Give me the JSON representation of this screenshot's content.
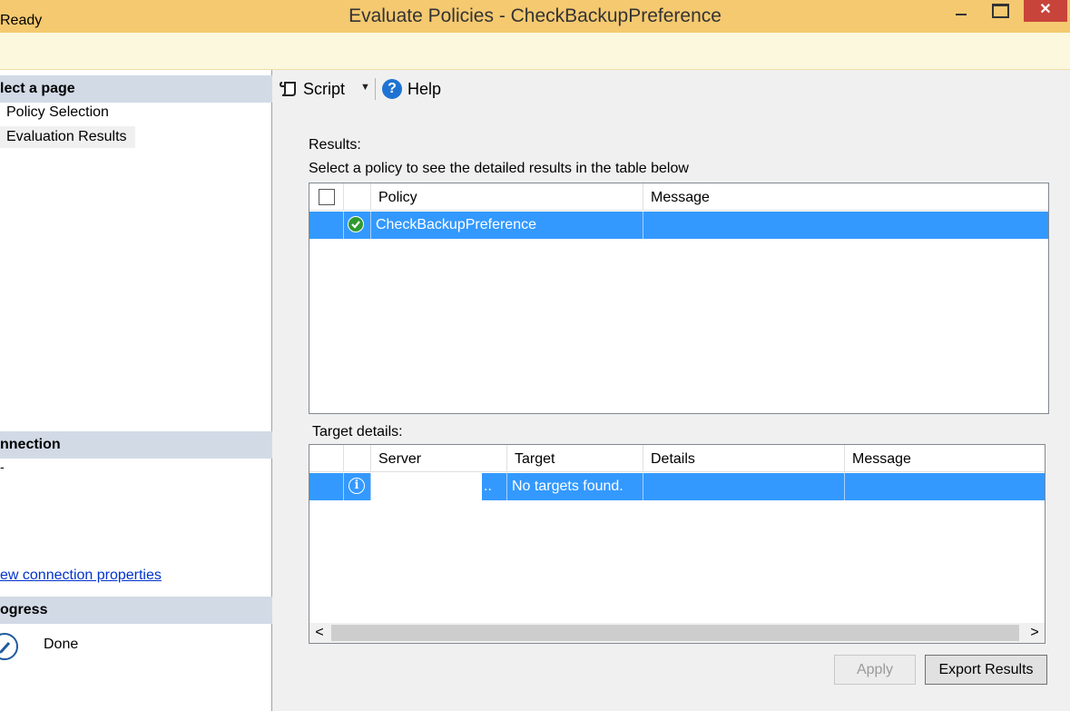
{
  "window": {
    "title": "Evaluate Policies - CheckBackupPreference",
    "minimize_icon": "minimize-icon",
    "maximize_icon": "maximize-icon",
    "close_glyph": "✕"
  },
  "status": {
    "text": "Ready"
  },
  "left_panel": {
    "select_page_header": "lect a page",
    "nav_items": [
      {
        "label": "Policy Selection"
      },
      {
        "label": "Evaluation Results"
      }
    ],
    "connection_header": "nnection",
    "connection_value": "-",
    "connection_link": "ew connection properties",
    "progress_header": "ogress",
    "progress_text": "Done"
  },
  "toolbar": {
    "script_label": "Script",
    "script_dropdown_glyph": "▼",
    "help_label": "Help",
    "help_glyph": "?"
  },
  "results": {
    "label": "Results:",
    "hint": "Select a policy to see the detailed results in the table below",
    "columns": [
      "Policy",
      "Message"
    ],
    "rows": [
      {
        "status_icon": "success-check-icon",
        "policy": "CheckBackupPreference",
        "message": ""
      }
    ]
  },
  "target_details": {
    "label": "Target details:",
    "columns": [
      "Server",
      "Target",
      "Details",
      "Message"
    ],
    "rows": [
      {
        "status_icon": "info-icon",
        "info_glyph": "i",
        "server": "..",
        "target": "No targets found.",
        "details": "",
        "message": ""
      }
    ],
    "scroll_left_glyph": "<",
    "scroll_right_glyph": ">"
  },
  "buttons": {
    "apply": "Apply",
    "export": "Export Results"
  },
  "colors": {
    "titlebar": "#f5c970",
    "status_bar": "#fcf8de",
    "selection": "#3399ff",
    "section_header": "#d2dae6",
    "close_button": "#c8443a",
    "link": "#0033cc"
  }
}
